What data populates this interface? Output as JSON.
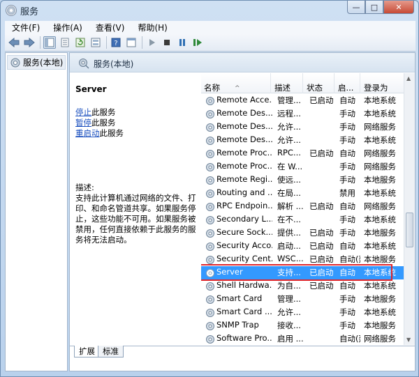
{
  "window": {
    "title": "服务"
  },
  "window_controls": {
    "minimize": "—",
    "maximize": "□",
    "close": "✕"
  },
  "menubar": [
    "文件(F)",
    "操作(A)",
    "查看(V)",
    "帮助(H)"
  ],
  "toolbar": [
    "back-icon",
    "forward-icon",
    "console-tree-icon",
    "properties-icon",
    "refresh-icon",
    "export-icon",
    "help-icon",
    "console-icon",
    "play-icon",
    "stop-icon",
    "pause-icon",
    "restart-icon"
  ],
  "tree": {
    "item": "服务(本地)"
  },
  "pane_header": {
    "title": "服务(本地)"
  },
  "desc_pane": {
    "service_name": "Server",
    "actions": [
      {
        "link": "停止",
        "rest": "此服务"
      },
      {
        "link": "暂停",
        "rest": "此服务"
      },
      {
        "link": "重启动",
        "rest": "此服务"
      }
    ],
    "desc_label": "描述:",
    "desc_text": "支持此计算机通过网络的文件、打印、和命名管道共享。如果服务停止，这些功能不可用。如果服务被禁用，任何直接依赖于此服务的服务将无法启动。"
  },
  "list": {
    "columns": [
      "名称",
      "描述",
      "状态",
      "启...",
      "登录为"
    ],
    "sort_indicator": "^",
    "rows": [
      {
        "name": "Remote Acce...",
        "desc": "管理...",
        "status": "已启动",
        "startup": "自动",
        "logon": "本地系统"
      },
      {
        "name": "Remote Des...",
        "desc": "远程...",
        "status": "",
        "startup": "手动",
        "logon": "本地系统"
      },
      {
        "name": "Remote Des...",
        "desc": "允许...",
        "status": "",
        "startup": "手动",
        "logon": "网络服务"
      },
      {
        "name": "Remote Des...",
        "desc": "允许...",
        "status": "",
        "startup": "手动",
        "logon": "本地系统"
      },
      {
        "name": "Remote Proc...",
        "desc": "RPC...",
        "status": "已启动",
        "startup": "自动",
        "logon": "网络服务"
      },
      {
        "name": "Remote Proc...",
        "desc": "在 W...",
        "status": "",
        "startup": "手动",
        "logon": "网络服务"
      },
      {
        "name": "Remote Regi...",
        "desc": "使远...",
        "status": "",
        "startup": "手动",
        "logon": "本地服务"
      },
      {
        "name": "Routing and ...",
        "desc": "在局...",
        "status": "",
        "startup": "禁用",
        "logon": "本地系统"
      },
      {
        "name": "RPC Endpoin...",
        "desc": "解析 ...",
        "status": "已启动",
        "startup": "自动",
        "logon": "网络服务"
      },
      {
        "name": "Secondary L...",
        "desc": "在不...",
        "status": "",
        "startup": "手动",
        "logon": "本地系统"
      },
      {
        "name": "Secure Sock...",
        "desc": "提供...",
        "status": "已启动",
        "startup": "手动",
        "logon": "本地服务"
      },
      {
        "name": "Security Acco...",
        "desc": "启动...",
        "status": "已启动",
        "startup": "自动",
        "logon": "本地系统"
      },
      {
        "name": "Security Cent...",
        "desc": "WSC...",
        "status": "已启动",
        "startup": "自动(延迟...",
        "logon": "本地服务"
      },
      {
        "name": "Server",
        "desc": "支持...",
        "status": "已启动",
        "startup": "自动",
        "logon": "本地系统",
        "selected": true
      },
      {
        "name": "Shell Hardwa...",
        "desc": "为自...",
        "status": "已启动",
        "startup": "自动",
        "logon": "本地系统"
      },
      {
        "name": "Smart Card",
        "desc": "管理...",
        "status": "",
        "startup": "手动",
        "logon": "本地服务"
      },
      {
        "name": "Smart Card ...",
        "desc": "允许...",
        "status": "",
        "startup": "手动",
        "logon": "本地系统"
      },
      {
        "name": "SNMP Trap",
        "desc": "接收...",
        "status": "",
        "startup": "手动",
        "logon": "本地服务"
      },
      {
        "name": "Software Pro...",
        "desc": "启用 ...",
        "status": "",
        "startup": "自动(延迟...",
        "logon": "网络服务"
      }
    ]
  },
  "tabs": [
    "扩展",
    "标准"
  ],
  "colors": {
    "selection": "#3399ff",
    "highlight_border": "#e0252b",
    "link": "#1a4fbf"
  }
}
